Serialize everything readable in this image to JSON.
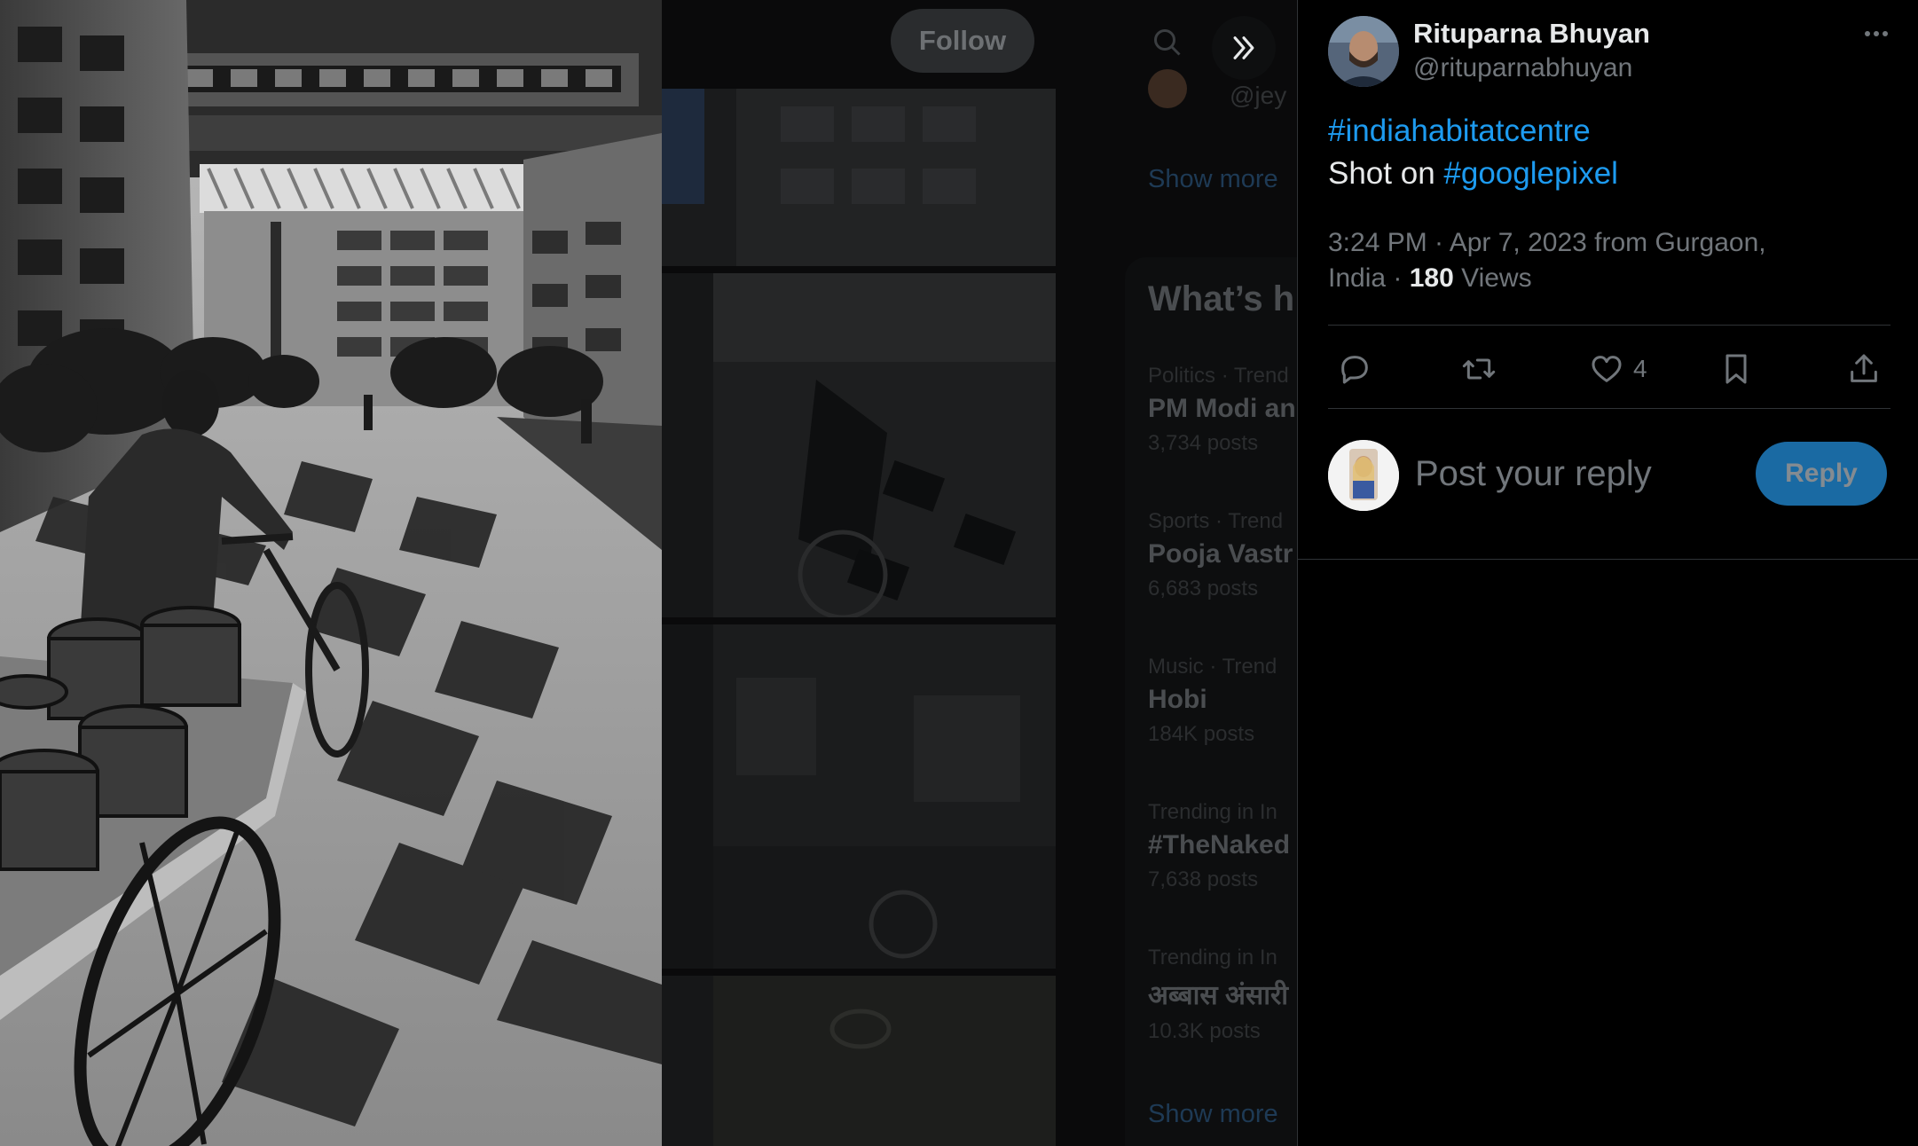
{
  "background": {
    "follow_label": "Follow",
    "whats_happening": "What’s h",
    "trends": [
      {
        "meta": "Politics · Trend",
        "name": "PM Modi an",
        "posts": "3,734 posts"
      },
      {
        "meta": "Sports · Trend",
        "name": "Pooja Vastr",
        "posts": "6,683 posts"
      },
      {
        "meta": "Music · Trend",
        "name": "Hobi",
        "posts": "184K posts"
      },
      {
        "meta": "Trending in In",
        "name": "#TheNaked",
        "posts": "7,638 posts"
      },
      {
        "meta": "Trending in In",
        "name": "अब्बास अंसारी",
        "posts": "10.3K posts"
      }
    ],
    "show_more": "Show more",
    "sidebar_user_snippet": "@jey"
  },
  "post": {
    "author_name": "Rituparna Bhuyan",
    "author_handle": "@rituparnabhuyan",
    "hashtag_1": "#indiahabitatcentre",
    "text_prefix": "Shot on ",
    "hashtag_2": "#googlepixel",
    "time": "3:24 PM · Apr 7, 2023 from Gurgaon,",
    "location_tail": "India · ",
    "views_count": "180",
    "views_label": " Views",
    "likes_count": "4"
  },
  "icons": {
    "expand": "double-chevron-right-icon",
    "more": "more-horizontal-icon",
    "reply": "reply-icon",
    "repost": "repost-icon",
    "like": "heart-icon",
    "bookmark": "bookmark-icon",
    "share": "share-icon"
  },
  "reply_box": {
    "placeholder": "Post your reply",
    "button_label": "Reply"
  },
  "colors": {
    "accent": "#1d9bf0",
    "reply_button": "#1a6aa3",
    "muted_text": "#71767b"
  }
}
